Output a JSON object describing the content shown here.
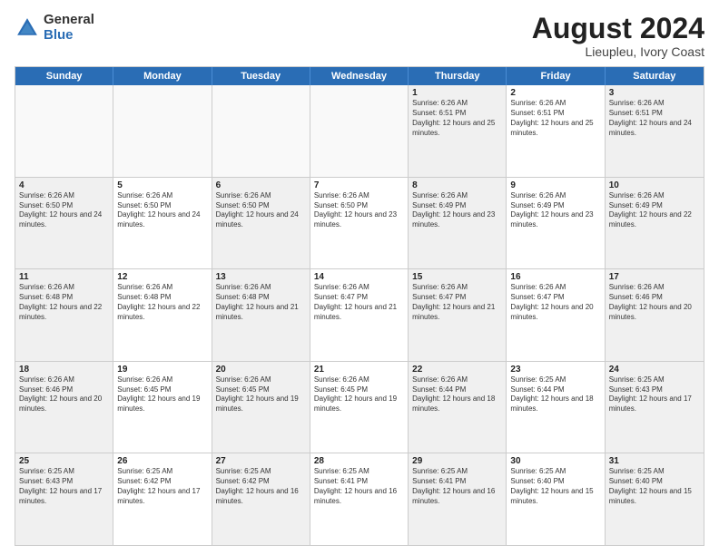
{
  "logo": {
    "general": "General",
    "blue": "Blue"
  },
  "header": {
    "title": "August 2024",
    "subtitle": "Lieupleu, Ivory Coast"
  },
  "days": [
    "Sunday",
    "Monday",
    "Tuesday",
    "Wednesday",
    "Thursday",
    "Friday",
    "Saturday"
  ],
  "weeks": [
    [
      {
        "day": "",
        "empty": true
      },
      {
        "day": "",
        "empty": true
      },
      {
        "day": "",
        "empty": true
      },
      {
        "day": "",
        "empty": true
      },
      {
        "day": "1",
        "sunrise": "6:26 AM",
        "sunset": "6:51 PM",
        "daylight": "12 hours and 25 minutes."
      },
      {
        "day": "2",
        "sunrise": "6:26 AM",
        "sunset": "6:51 PM",
        "daylight": "12 hours and 25 minutes."
      },
      {
        "day": "3",
        "sunrise": "6:26 AM",
        "sunset": "6:51 PM",
        "daylight": "12 hours and 24 minutes."
      }
    ],
    [
      {
        "day": "4",
        "sunrise": "6:26 AM",
        "sunset": "6:50 PM",
        "daylight": "12 hours and 24 minutes."
      },
      {
        "day": "5",
        "sunrise": "6:26 AM",
        "sunset": "6:50 PM",
        "daylight": "12 hours and 24 minutes."
      },
      {
        "day": "6",
        "sunrise": "6:26 AM",
        "sunset": "6:50 PM",
        "daylight": "12 hours and 24 minutes."
      },
      {
        "day": "7",
        "sunrise": "6:26 AM",
        "sunset": "6:50 PM",
        "daylight": "12 hours and 23 minutes."
      },
      {
        "day": "8",
        "sunrise": "6:26 AM",
        "sunset": "6:49 PM",
        "daylight": "12 hours and 23 minutes."
      },
      {
        "day": "9",
        "sunrise": "6:26 AM",
        "sunset": "6:49 PM",
        "daylight": "12 hours and 23 minutes."
      },
      {
        "day": "10",
        "sunrise": "6:26 AM",
        "sunset": "6:49 PM",
        "daylight": "12 hours and 22 minutes."
      }
    ],
    [
      {
        "day": "11",
        "sunrise": "6:26 AM",
        "sunset": "6:48 PM",
        "daylight": "12 hours and 22 minutes."
      },
      {
        "day": "12",
        "sunrise": "6:26 AM",
        "sunset": "6:48 PM",
        "daylight": "12 hours and 22 minutes."
      },
      {
        "day": "13",
        "sunrise": "6:26 AM",
        "sunset": "6:48 PM",
        "daylight": "12 hours and 21 minutes."
      },
      {
        "day": "14",
        "sunrise": "6:26 AM",
        "sunset": "6:47 PM",
        "daylight": "12 hours and 21 minutes."
      },
      {
        "day": "15",
        "sunrise": "6:26 AM",
        "sunset": "6:47 PM",
        "daylight": "12 hours and 21 minutes."
      },
      {
        "day": "16",
        "sunrise": "6:26 AM",
        "sunset": "6:47 PM",
        "daylight": "12 hours and 20 minutes."
      },
      {
        "day": "17",
        "sunrise": "6:26 AM",
        "sunset": "6:46 PM",
        "daylight": "12 hours and 20 minutes."
      }
    ],
    [
      {
        "day": "18",
        "sunrise": "6:26 AM",
        "sunset": "6:46 PM",
        "daylight": "12 hours and 20 minutes."
      },
      {
        "day": "19",
        "sunrise": "6:26 AM",
        "sunset": "6:45 PM",
        "daylight": "12 hours and 19 minutes."
      },
      {
        "day": "20",
        "sunrise": "6:26 AM",
        "sunset": "6:45 PM",
        "daylight": "12 hours and 19 minutes."
      },
      {
        "day": "21",
        "sunrise": "6:26 AM",
        "sunset": "6:45 PM",
        "daylight": "12 hours and 19 minutes."
      },
      {
        "day": "22",
        "sunrise": "6:26 AM",
        "sunset": "6:44 PM",
        "daylight": "12 hours and 18 minutes."
      },
      {
        "day": "23",
        "sunrise": "6:25 AM",
        "sunset": "6:44 PM",
        "daylight": "12 hours and 18 minutes."
      },
      {
        "day": "24",
        "sunrise": "6:25 AM",
        "sunset": "6:43 PM",
        "daylight": "12 hours and 17 minutes."
      }
    ],
    [
      {
        "day": "25",
        "sunrise": "6:25 AM",
        "sunset": "6:43 PM",
        "daylight": "12 hours and 17 minutes."
      },
      {
        "day": "26",
        "sunrise": "6:25 AM",
        "sunset": "6:42 PM",
        "daylight": "12 hours and 17 minutes."
      },
      {
        "day": "27",
        "sunrise": "6:25 AM",
        "sunset": "6:42 PM",
        "daylight": "12 hours and 16 minutes."
      },
      {
        "day": "28",
        "sunrise": "6:25 AM",
        "sunset": "6:41 PM",
        "daylight": "12 hours and 16 minutes."
      },
      {
        "day": "29",
        "sunrise": "6:25 AM",
        "sunset": "6:41 PM",
        "daylight": "12 hours and 16 minutes."
      },
      {
        "day": "30",
        "sunrise": "6:25 AM",
        "sunset": "6:40 PM",
        "daylight": "12 hours and 15 minutes."
      },
      {
        "day": "31",
        "sunrise": "6:25 AM",
        "sunset": "6:40 PM",
        "daylight": "12 hours and 15 minutes."
      }
    ]
  ]
}
